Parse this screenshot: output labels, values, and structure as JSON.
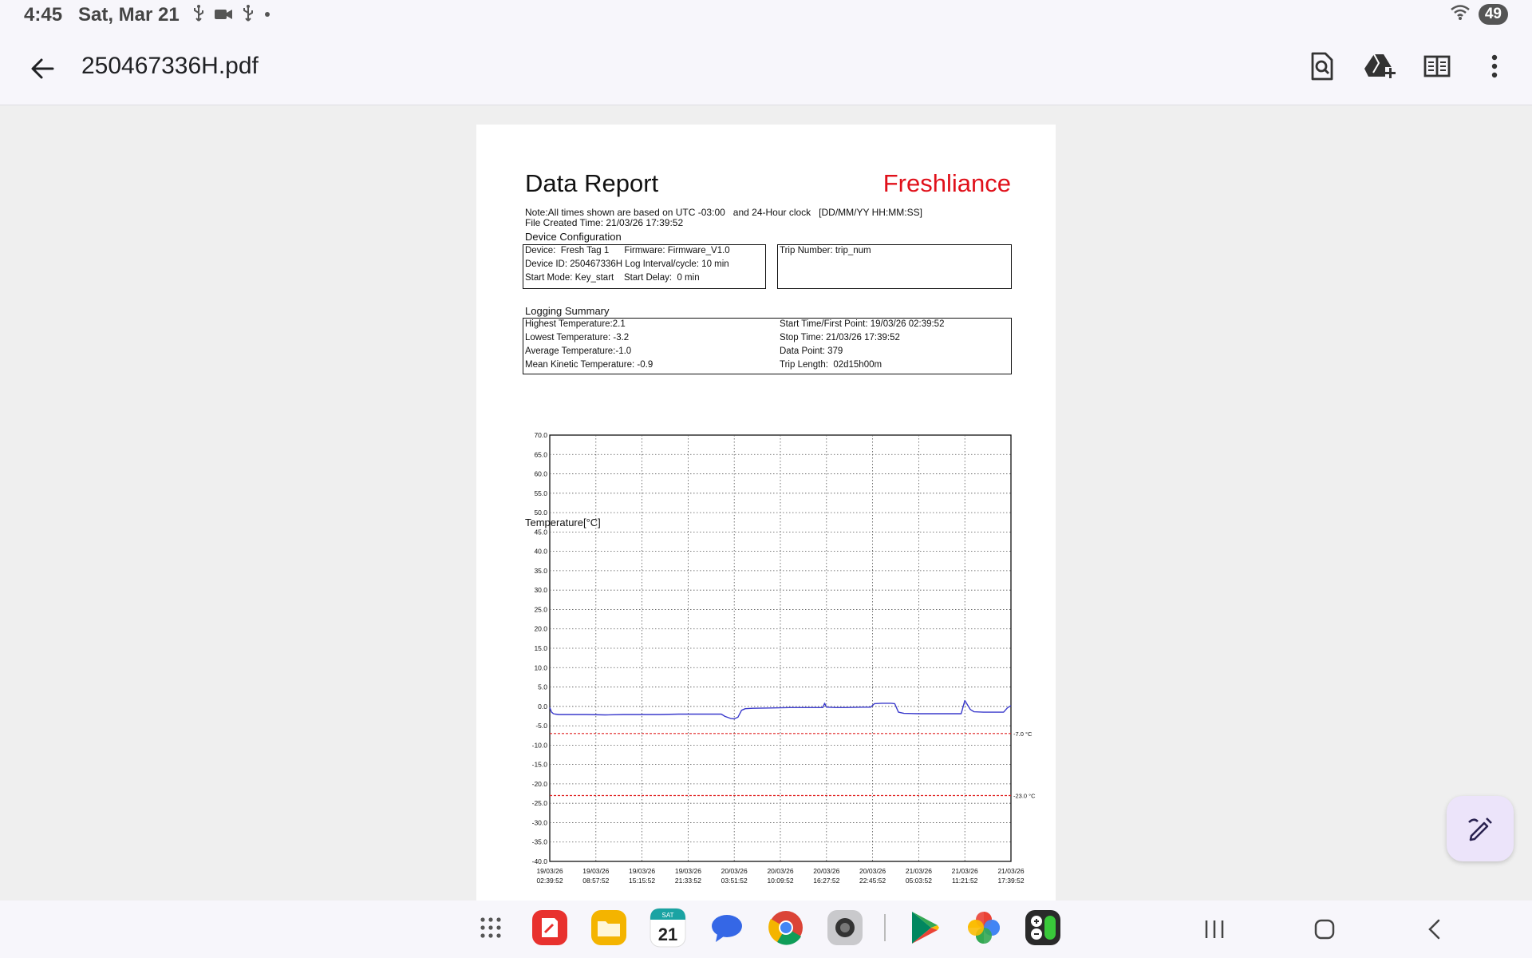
{
  "status_bar": {
    "time": "4:45",
    "date": "Sat, Mar 21",
    "battery": "49",
    "icons": [
      "usb-icon",
      "video-camera-icon",
      "usb-icon",
      "dot-icon",
      "wifi-icon"
    ]
  },
  "app_bar": {
    "file_name": "250467336H.pdf",
    "actions": [
      "search-in-document-icon",
      "add-to-drive-icon",
      "reading-mode-icon",
      "more-options-icon"
    ]
  },
  "report": {
    "title": "Data Report",
    "brand": "Freshliance",
    "brand_color": "#e0101a",
    "note": "Note:All times shown are based on UTC -03:00   and 24-Hour clock   [DD/MM/YY HH:MM:SS]",
    "file_created": "File Created Time: 21/03/26 17:39:52",
    "device_config": {
      "label": "Device Configuration",
      "lines": [
        "Device:  Fresh Tag 1      Firmware: Firmware_V1.0",
        "Device ID: 250467336H Log Interval/cycle: 10 min",
        "Start Mode: Key_start    Start Delay:  0 min"
      ],
      "trip_number": "Trip Number: trip_num"
    },
    "logging_summary": {
      "label": "Logging Summary",
      "left": [
        "Highest Temperature:2.1",
        "Lowest Temperature: -3.2",
        "Average Temperature:-1.0",
        "Mean Kinetic Temperature: -0.9"
      ],
      "right": [
        "Start Time/First Point: 19/03/26 02:39:52",
        "Stop Time: 21/03/26 17:39:52",
        "Data Point: 379",
        "Trip Length:  02d15h00m"
      ]
    }
  },
  "chart_data": {
    "type": "line",
    "ylabel": "Temperature[°C]",
    "ylim": [
      -40.0,
      70.0
    ],
    "y_ticks": [
      "70.0",
      "65.0",
      "60.0",
      "55.0",
      "50.0",
      "45.0",
      "40.0",
      "35.0",
      "30.0",
      "25.0",
      "20.0",
      "15.0",
      "10.0",
      "5.0",
      "0.0",
      "-5.0",
      "-10.0",
      "-15.0",
      "-20.0",
      "-25.0",
      "-30.0",
      "-35.0",
      "-40.0"
    ],
    "x_ticks": [
      [
        "19/03/26",
        "02:39:52"
      ],
      [
        "19/03/26",
        "08:57:52"
      ],
      [
        "19/03/26",
        "15:15:52"
      ],
      [
        "19/03/26",
        "21:33:52"
      ],
      [
        "20/03/26",
        "03:51:52"
      ],
      [
        "20/03/26",
        "10:09:52"
      ],
      [
        "20/03/26",
        "16:27:52"
      ],
      [
        "20/03/26",
        "22:45:52"
      ],
      [
        "21/03/26",
        "05:03:52"
      ],
      [
        "21/03/26",
        "11:21:52"
      ],
      [
        "21/03/26",
        "17:39:52"
      ]
    ],
    "grid": true,
    "thresholds": [
      {
        "value": -7.0,
        "label": "-7.0  °C",
        "color": "#e02020"
      },
      {
        "value": -23.0,
        "label": "-23.0 °C",
        "color": "#e02020"
      }
    ],
    "series": [
      {
        "color": "#3a3acc",
        "points": [
          [
            0.0,
            -0.3
          ],
          [
            0.1,
            -1.5
          ],
          [
            0.2,
            -1.9
          ],
          [
            0.3,
            -2.0
          ],
          [
            0.5,
            -2.1
          ],
          [
            1,
            -2.1
          ],
          [
            2,
            -2.1
          ],
          [
            3,
            -2.2
          ],
          [
            4,
            -2.1
          ],
          [
            5,
            -2.1
          ],
          [
            6,
            -2.1
          ],
          [
            7,
            -2.0
          ],
          [
            8,
            -2.0
          ],
          [
            9,
            -2.0
          ],
          [
            9.3,
            -2.0
          ],
          [
            9.5,
            -2.6
          ],
          [
            9.8,
            -3.1
          ],
          [
            10.0,
            -3.2
          ],
          [
            10.2,
            -2.8
          ],
          [
            10.4,
            -1.0
          ],
          [
            10.6,
            -0.6
          ],
          [
            11,
            -0.5
          ],
          [
            12,
            -0.4
          ],
          [
            13,
            -0.3
          ],
          [
            14,
            -0.3
          ],
          [
            14.8,
            -0.3
          ],
          [
            14.9,
            0.8
          ],
          [
            15.0,
            -0.2
          ],
          [
            15.5,
            -0.3
          ],
          [
            16,
            -0.3
          ],
          [
            17,
            -0.2
          ],
          [
            17.4,
            -0.2
          ],
          [
            17.6,
            0.7
          ],
          [
            18,
            0.8
          ],
          [
            18.5,
            0.8
          ],
          [
            18.7,
            0.7
          ],
          [
            18.9,
            -1.5
          ],
          [
            19.2,
            -1.8
          ],
          [
            20,
            -1.9
          ],
          [
            21,
            -1.9
          ],
          [
            22,
            -1.9
          ],
          [
            22.3,
            -1.9
          ],
          [
            22.5,
            1.5
          ],
          [
            22.8,
            -0.8
          ],
          [
            23,
            -1.4
          ],
          [
            23.5,
            -1.5
          ],
          [
            24.6,
            -1.5
          ],
          [
            24.8,
            -0.4
          ],
          [
            25.0,
            0.2
          ]
        ]
      }
    ]
  },
  "dock": {
    "apps": [
      "app-drawer-icon",
      "notes-app-icon",
      "my-files-app-icon",
      "calendar-app-icon",
      "messages-app-icon",
      "chrome-app-icon",
      "camera-app-icon",
      "play-store-app-icon",
      "photos-app-icon",
      "calculator-app-icon"
    ],
    "calendar_day": "SAT",
    "calendar_date": "21"
  },
  "system_nav": [
    "recent-apps-icon",
    "home-icon",
    "back-nav-icon"
  ]
}
